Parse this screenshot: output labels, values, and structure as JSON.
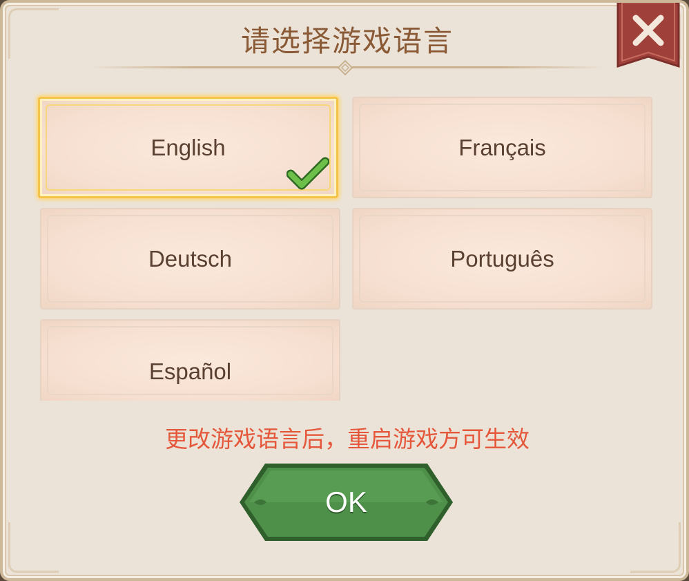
{
  "dialog": {
    "title": "请选择游戏语言",
    "notice": "更改游戏语言后，重启游戏方可生效",
    "ok_label": "OK"
  },
  "languages": [
    {
      "label": "English",
      "selected": true
    },
    {
      "label": "Français",
      "selected": false
    },
    {
      "label": "Deutsch",
      "selected": false
    },
    {
      "label": "Português",
      "selected": false
    },
    {
      "label": "Español",
      "selected": false
    }
  ],
  "icons": {
    "close": "close-icon",
    "check": "checkmark-icon"
  },
  "colors": {
    "title": "#8a5a36",
    "notice": "#e4573a",
    "ok_button": "#4e8f4a",
    "close_banner": "#a0403a",
    "selected_border": "#f5c24a",
    "check": "#58b039"
  }
}
